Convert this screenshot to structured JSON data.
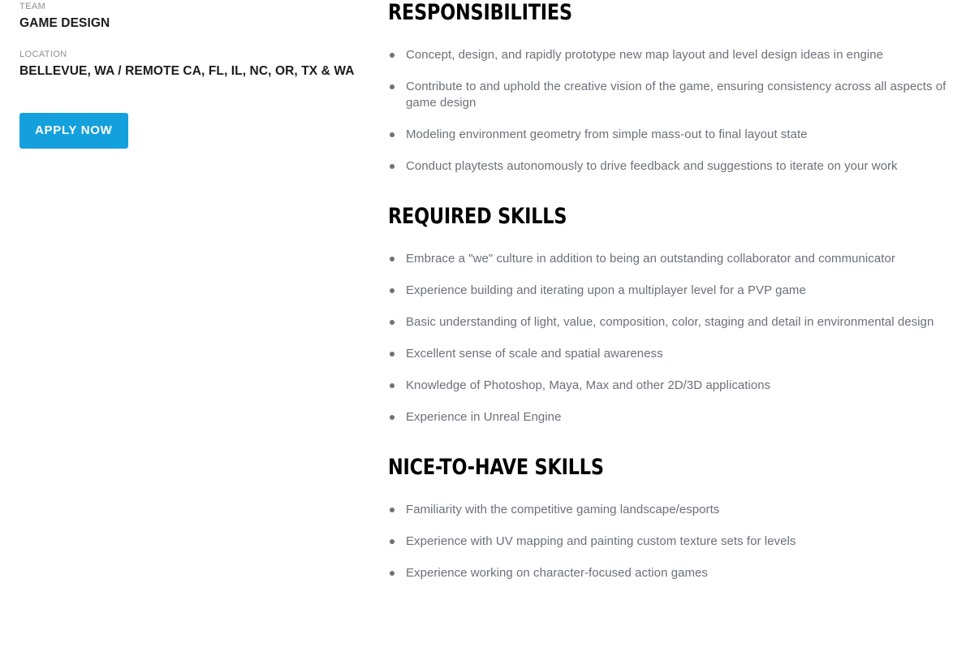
{
  "sidebar": {
    "team": {
      "label": "TEAM",
      "value": "GAME DESIGN"
    },
    "location": {
      "label": "LOCATION",
      "value": "BELLEVUE, WA / REMOTE CA, FL, IL, NC, OR, TX & WA"
    },
    "apply_button_label": "APPLY NOW",
    "apply_button_color": "#14a0dd"
  },
  "content": {
    "sections": [
      {
        "heading": "RESPONSIBILITIES",
        "bullets": [
          "Concept, design, and rapidly prototype new map layout and level design ideas in engine",
          "Contribute to and uphold the creative vision of the game, ensuring consistency across all aspects of game design",
          "Modeling environment geometry from simple mass-out to final layout state",
          "Conduct playtests autonomously to drive feedback and suggestions to iterate on your work"
        ]
      },
      {
        "heading": "REQUIRED SKILLS",
        "bullets": [
          "Embrace a \"we\" culture in addition to being an outstanding collaborator and communicator",
          "Experience building and iterating upon a multiplayer level for a PVP game",
          "Basic understanding of light, value, composition, color, staging and detail in environmental design",
          "Excellent sense of scale and spatial awareness",
          "Knowledge of Photoshop, Maya, Max and other 2D/3D applications",
          "Experience in Unreal Engine"
        ]
      },
      {
        "heading": "NICE-TO-HAVE SKILLS",
        "bullets": [
          "Familiarity with the competitive gaming landscape/esports",
          "Experience with UV mapping and painting custom texture sets for levels",
          "Experience working on character-focused action games"
        ]
      }
    ]
  },
  "colors": {
    "heading": "#000000",
    "body_text": "#6b7079",
    "meta_label": "#8b8f94",
    "meta_value": "#1b1b1b",
    "accent": "#14a0dd",
    "background": "#ffffff"
  }
}
